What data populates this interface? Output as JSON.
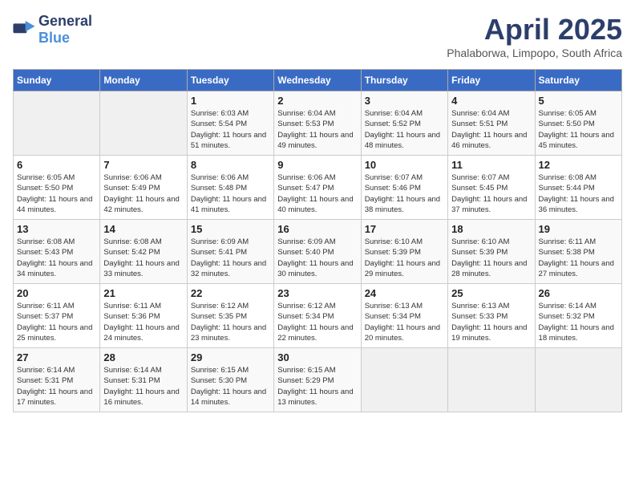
{
  "logo": {
    "text_general": "General",
    "text_blue": "Blue"
  },
  "title": "April 2025",
  "location": "Phalaborwa, Limpopo, South Africa",
  "weekdays": [
    "Sunday",
    "Monday",
    "Tuesday",
    "Wednesday",
    "Thursday",
    "Friday",
    "Saturday"
  ],
  "weeks": [
    [
      null,
      null,
      {
        "day": "1",
        "sunrise": "Sunrise: 6:03 AM",
        "sunset": "Sunset: 5:54 PM",
        "daylight": "Daylight: 11 hours and 51 minutes."
      },
      {
        "day": "2",
        "sunrise": "Sunrise: 6:04 AM",
        "sunset": "Sunset: 5:53 PM",
        "daylight": "Daylight: 11 hours and 49 minutes."
      },
      {
        "day": "3",
        "sunrise": "Sunrise: 6:04 AM",
        "sunset": "Sunset: 5:52 PM",
        "daylight": "Daylight: 11 hours and 48 minutes."
      },
      {
        "day": "4",
        "sunrise": "Sunrise: 6:04 AM",
        "sunset": "Sunset: 5:51 PM",
        "daylight": "Daylight: 11 hours and 46 minutes."
      },
      {
        "day": "5",
        "sunrise": "Sunrise: 6:05 AM",
        "sunset": "Sunset: 5:50 PM",
        "daylight": "Daylight: 11 hours and 45 minutes."
      }
    ],
    [
      {
        "day": "6",
        "sunrise": "Sunrise: 6:05 AM",
        "sunset": "Sunset: 5:50 PM",
        "daylight": "Daylight: 11 hours and 44 minutes."
      },
      {
        "day": "7",
        "sunrise": "Sunrise: 6:06 AM",
        "sunset": "Sunset: 5:49 PM",
        "daylight": "Daylight: 11 hours and 42 minutes."
      },
      {
        "day": "8",
        "sunrise": "Sunrise: 6:06 AM",
        "sunset": "Sunset: 5:48 PM",
        "daylight": "Daylight: 11 hours and 41 minutes."
      },
      {
        "day": "9",
        "sunrise": "Sunrise: 6:06 AM",
        "sunset": "Sunset: 5:47 PM",
        "daylight": "Daylight: 11 hours and 40 minutes."
      },
      {
        "day": "10",
        "sunrise": "Sunrise: 6:07 AM",
        "sunset": "Sunset: 5:46 PM",
        "daylight": "Daylight: 11 hours and 38 minutes."
      },
      {
        "day": "11",
        "sunrise": "Sunrise: 6:07 AM",
        "sunset": "Sunset: 5:45 PM",
        "daylight": "Daylight: 11 hours and 37 minutes."
      },
      {
        "day": "12",
        "sunrise": "Sunrise: 6:08 AM",
        "sunset": "Sunset: 5:44 PM",
        "daylight": "Daylight: 11 hours and 36 minutes."
      }
    ],
    [
      {
        "day": "13",
        "sunrise": "Sunrise: 6:08 AM",
        "sunset": "Sunset: 5:43 PM",
        "daylight": "Daylight: 11 hours and 34 minutes."
      },
      {
        "day": "14",
        "sunrise": "Sunrise: 6:08 AM",
        "sunset": "Sunset: 5:42 PM",
        "daylight": "Daylight: 11 hours and 33 minutes."
      },
      {
        "day": "15",
        "sunrise": "Sunrise: 6:09 AM",
        "sunset": "Sunset: 5:41 PM",
        "daylight": "Daylight: 11 hours and 32 minutes."
      },
      {
        "day": "16",
        "sunrise": "Sunrise: 6:09 AM",
        "sunset": "Sunset: 5:40 PM",
        "daylight": "Daylight: 11 hours and 30 minutes."
      },
      {
        "day": "17",
        "sunrise": "Sunrise: 6:10 AM",
        "sunset": "Sunset: 5:39 PM",
        "daylight": "Daylight: 11 hours and 29 minutes."
      },
      {
        "day": "18",
        "sunrise": "Sunrise: 6:10 AM",
        "sunset": "Sunset: 5:39 PM",
        "daylight": "Daylight: 11 hours and 28 minutes."
      },
      {
        "day": "19",
        "sunrise": "Sunrise: 6:11 AM",
        "sunset": "Sunset: 5:38 PM",
        "daylight": "Daylight: 11 hours and 27 minutes."
      }
    ],
    [
      {
        "day": "20",
        "sunrise": "Sunrise: 6:11 AM",
        "sunset": "Sunset: 5:37 PM",
        "daylight": "Daylight: 11 hours and 25 minutes."
      },
      {
        "day": "21",
        "sunrise": "Sunrise: 6:11 AM",
        "sunset": "Sunset: 5:36 PM",
        "daylight": "Daylight: 11 hours and 24 minutes."
      },
      {
        "day": "22",
        "sunrise": "Sunrise: 6:12 AM",
        "sunset": "Sunset: 5:35 PM",
        "daylight": "Daylight: 11 hours and 23 minutes."
      },
      {
        "day": "23",
        "sunrise": "Sunrise: 6:12 AM",
        "sunset": "Sunset: 5:34 PM",
        "daylight": "Daylight: 11 hours and 22 minutes."
      },
      {
        "day": "24",
        "sunrise": "Sunrise: 6:13 AM",
        "sunset": "Sunset: 5:34 PM",
        "daylight": "Daylight: 11 hours and 20 minutes."
      },
      {
        "day": "25",
        "sunrise": "Sunrise: 6:13 AM",
        "sunset": "Sunset: 5:33 PM",
        "daylight": "Daylight: 11 hours and 19 minutes."
      },
      {
        "day": "26",
        "sunrise": "Sunrise: 6:14 AM",
        "sunset": "Sunset: 5:32 PM",
        "daylight": "Daylight: 11 hours and 18 minutes."
      }
    ],
    [
      {
        "day": "27",
        "sunrise": "Sunrise: 6:14 AM",
        "sunset": "Sunset: 5:31 PM",
        "daylight": "Daylight: 11 hours and 17 minutes."
      },
      {
        "day": "28",
        "sunrise": "Sunrise: 6:14 AM",
        "sunset": "Sunset: 5:31 PM",
        "daylight": "Daylight: 11 hours and 16 minutes."
      },
      {
        "day": "29",
        "sunrise": "Sunrise: 6:15 AM",
        "sunset": "Sunset: 5:30 PM",
        "daylight": "Daylight: 11 hours and 14 minutes."
      },
      {
        "day": "30",
        "sunrise": "Sunrise: 6:15 AM",
        "sunset": "Sunset: 5:29 PM",
        "daylight": "Daylight: 11 hours and 13 minutes."
      },
      null,
      null,
      null
    ]
  ]
}
